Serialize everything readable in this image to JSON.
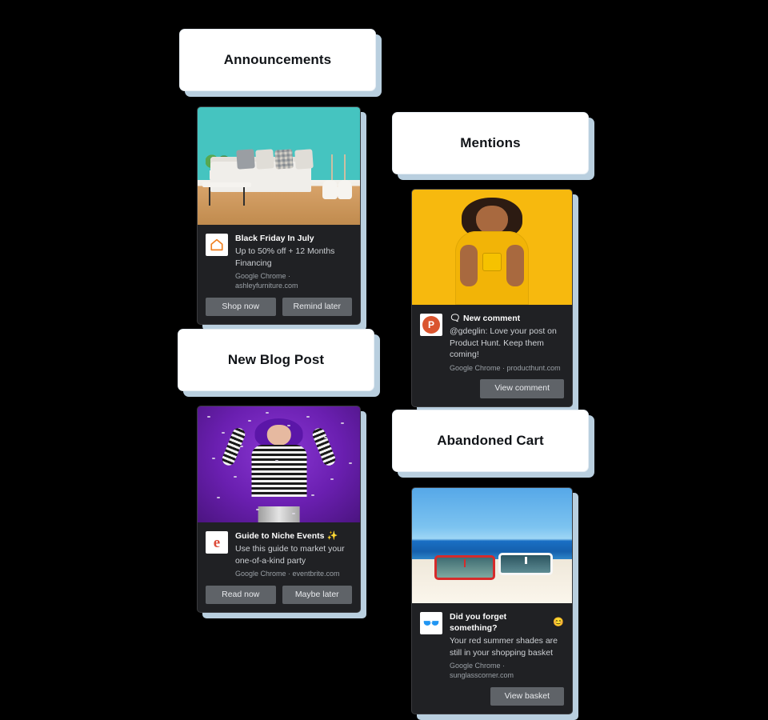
{
  "page": {
    "background_color": "#000000",
    "shadow_color": "#b9cfdf",
    "notification_bg": "#202124",
    "notification_button_bg": "#5f6368"
  },
  "sections": [
    {
      "id": "announcements",
      "label": "Announcements",
      "notification": {
        "title": "Black Friday In July",
        "message": "Up to 50% off + 12 Months Financing",
        "origin": "Google Chrome · ashleyfurniture.com",
        "browser": "Google Chrome",
        "site": "ashleyfurniture.com",
        "icon_name": "house-icon",
        "icon_color": "#f08020",
        "hero_alt": "teal living room with white sofa",
        "actions": [
          {
            "label": "Shop now"
          },
          {
            "label": "Remind later"
          }
        ]
      }
    },
    {
      "id": "mentions",
      "label": "Mentions",
      "notification": {
        "title": "New comment",
        "title_emoji": "🗨",
        "message": "@gdeglin: Love your post on Product Hunt. Keep them coming!",
        "origin": "Google Chrome · producthunt.com",
        "browser": "Google Chrome",
        "site": "producthunt.com",
        "icon_name": "product-hunt-icon",
        "icon_letter": "P",
        "icon_color": "#da552f",
        "hero_alt": "woman in yellow shirt on yellow background using phone",
        "actions": [
          {
            "label": "View comment"
          }
        ]
      }
    },
    {
      "id": "new-blog-post",
      "label": "New Blog Post",
      "notification": {
        "title": "Guide to Niche Events",
        "title_emoji": "✨",
        "message": "Use this guide to market your one-of-a-kind party",
        "origin": "Google Chrome · eventbrite.com",
        "browser": "Google Chrome",
        "site": "eventbrite.com",
        "icon_name": "eventbrite-icon",
        "icon_letter": "e",
        "icon_color": "#dd4b39",
        "hero_alt": "woman with purple hair celebrating with confetti",
        "actions": [
          {
            "label": "Read now"
          },
          {
            "label": "Maybe later"
          }
        ]
      }
    },
    {
      "id": "abandoned-cart",
      "label": "Abandoned Cart",
      "notification": {
        "title": "Did you forget something?",
        "title_emoji": "😊",
        "message": "Your red summer shades are still in your shopping basket",
        "origin": "Google Chrome · sunglasscorner.com",
        "browser": "Google Chrome",
        "site": "sunglasscorner.com",
        "icon_name": "sunglasses-icon",
        "icon_color": "#2196f3",
        "hero_alt": "red and white sunglasses on a beach",
        "actions": [
          {
            "label": "View basket"
          }
        ]
      }
    }
  ]
}
